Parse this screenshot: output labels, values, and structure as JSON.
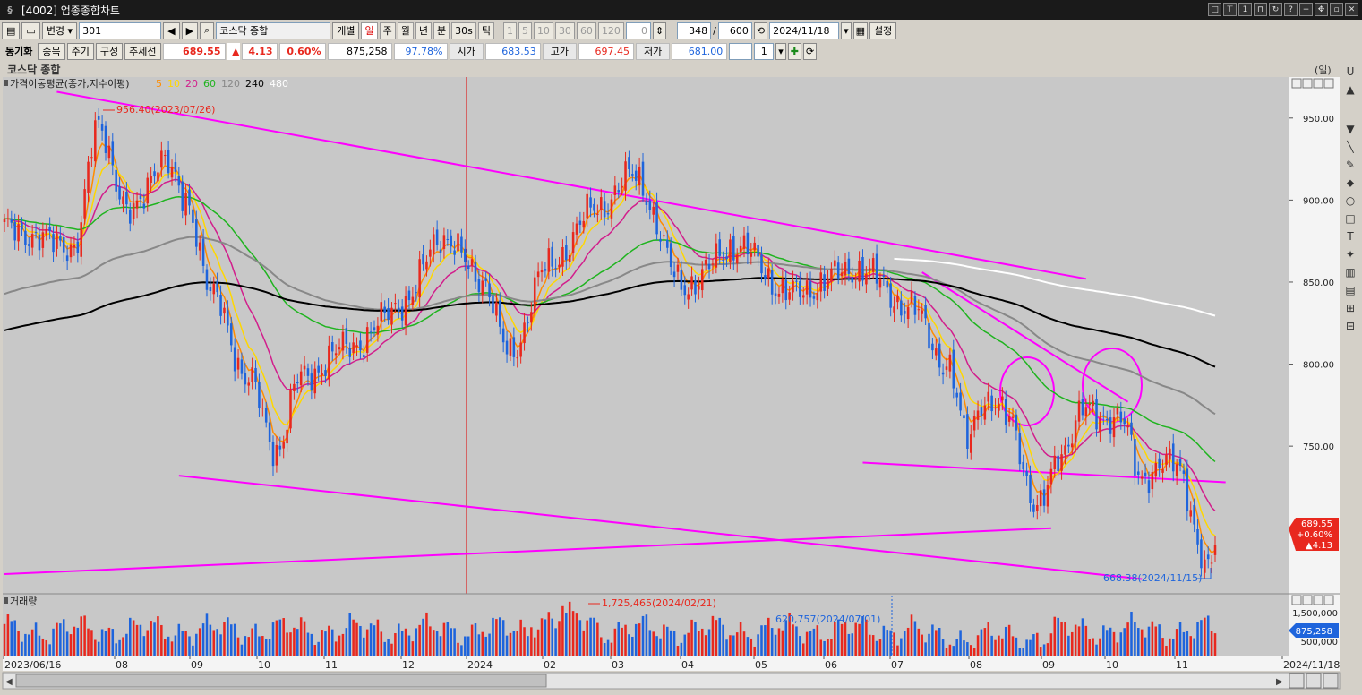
{
  "window": {
    "title": "[4002] 업종종합차트"
  },
  "toolbar": {
    "change_label": "변경",
    "code": "301",
    "name": "코스닥 종합",
    "individual_label": "개별",
    "periods": [
      "일",
      "주",
      "월",
      "년",
      "분",
      "30s",
      "틱"
    ],
    "active_period": "일",
    "minute_options": [
      "1",
      "5",
      "10",
      "30",
      "60",
      "120"
    ],
    "zero": "0",
    "count": "348",
    "slash": "/",
    "total": "600",
    "date": "2024/11/18",
    "settings_label": "설정"
  },
  "row2": {
    "sync_label": "동기화",
    "item_label": "종목",
    "cycle_label": "주기",
    "compose_label": "구성",
    "trend_label": "추세선",
    "price": "689.55",
    "arrow": "▲",
    "change": "4.13",
    "change_pct": "0.60%",
    "volume": "875,258",
    "vol_ratio": "97.78%",
    "open_label": "시가",
    "open": "683.53",
    "high_label": "고가",
    "high": "697.45",
    "low_label": "저가",
    "low": "681.00",
    "multiplier": "1"
  },
  "chart": {
    "title": "코스닥 종합",
    "unit": "(일)",
    "indicator_label": "가격이동평균(종가,지수이평)",
    "ma_periods": [
      {
        "label": "5",
        "color": "#ff8c00"
      },
      {
        "label": "10",
        "color": "#ffd700"
      },
      {
        "label": "20",
        "color": "#d21e8c"
      },
      {
        "label": "60",
        "color": "#1fb41f"
      },
      {
        "label": "120",
        "color": "#888888"
      },
      {
        "label": "240",
        "color": "#000000"
      },
      {
        "label": "480",
        "color": "#ffffff"
      }
    ],
    "volume_label": "거래량",
    "high_annotation": "956.40(2023/07/26)",
    "low_annotation": "668.38(2024/11/15)",
    "vol_high_annotation": "1,725,465(2024/02/21)",
    "vol_mark_annotation": "620,757(2024/07/01)",
    "last_price_box": [
      "689.55",
      "+0.60%",
      "▲4.13"
    ],
    "last_volume_box": "875,258",
    "colors": {
      "up": "#e8281e",
      "down": "#1e64dc",
      "trendline": "#ff00ff",
      "background": "#c8c8c8"
    }
  },
  "chart_data": {
    "type": "candlestick",
    "price_axis": {
      "ticks": [
        "950.00",
        "900.00",
        "850.00",
        "800.00",
        "750.00",
        "700.00"
      ],
      "ylim": [
        660,
        975
      ]
    },
    "volume_axis": {
      "ticks": [
        "1,500,000",
        "500,000"
      ]
    },
    "x_ticks": [
      "2023/06/16",
      "08",
      "09",
      "10",
      "11",
      "12",
      "2024",
      "02",
      "03",
      "04",
      "05",
      "06",
      "07",
      "08",
      "09",
      "10",
      "11",
      "2024/11/18"
    ],
    "anchors": [
      {
        "t": 0,
        "v": 882
      },
      {
        "t": 20,
        "v": 872
      },
      {
        "t": 27,
        "v": 945
      },
      {
        "t": 36,
        "v": 890
      },
      {
        "t": 45,
        "v": 925
      },
      {
        "t": 52,
        "v": 900
      },
      {
        "t": 60,
        "v": 840
      },
      {
        "t": 70,
        "v": 790
      },
      {
        "t": 78,
        "v": 748
      },
      {
        "t": 85,
        "v": 792
      },
      {
        "t": 100,
        "v": 812
      },
      {
        "t": 115,
        "v": 838
      },
      {
        "t": 125,
        "v": 878
      },
      {
        "t": 137,
        "v": 852
      },
      {
        "t": 145,
        "v": 805
      },
      {
        "t": 155,
        "v": 858
      },
      {
        "t": 170,
        "v": 895
      },
      {
        "t": 180,
        "v": 915
      },
      {
        "t": 195,
        "v": 848
      },
      {
        "t": 210,
        "v": 872
      },
      {
        "t": 225,
        "v": 843
      },
      {
        "t": 245,
        "v": 858
      },
      {
        "t": 260,
        "v": 834
      },
      {
        "t": 270,
        "v": 800
      },
      {
        "t": 276,
        "v": 755
      },
      {
        "t": 280,
        "v": 778
      },
      {
        "t": 288,
        "v": 768
      },
      {
        "t": 296,
        "v": 710
      },
      {
        "t": 303,
        "v": 748
      },
      {
        "t": 310,
        "v": 772
      },
      {
        "t": 320,
        "v": 765
      },
      {
        "t": 326,
        "v": 732
      },
      {
        "t": 336,
        "v": 740
      },
      {
        "t": 345,
        "v": 672
      },
      {
        "t": 347,
        "v": 689.55
      }
    ],
    "trendlines": [
      {
        "from": [
          15,
          966
        ],
        "to": [
          310,
          852
        ]
      },
      {
        "from": [
          50,
          732
        ],
        "to": [
          326,
          669
        ]
      },
      {
        "from": [
          0,
          672
        ],
        "to": [
          300,
          700
        ]
      },
      {
        "from": [
          246,
          740
        ],
        "to": [
          350,
          728
        ]
      },
      {
        "from": [
          263,
          856
        ],
        "to": [
          322,
          777
        ]
      }
    ]
  }
}
